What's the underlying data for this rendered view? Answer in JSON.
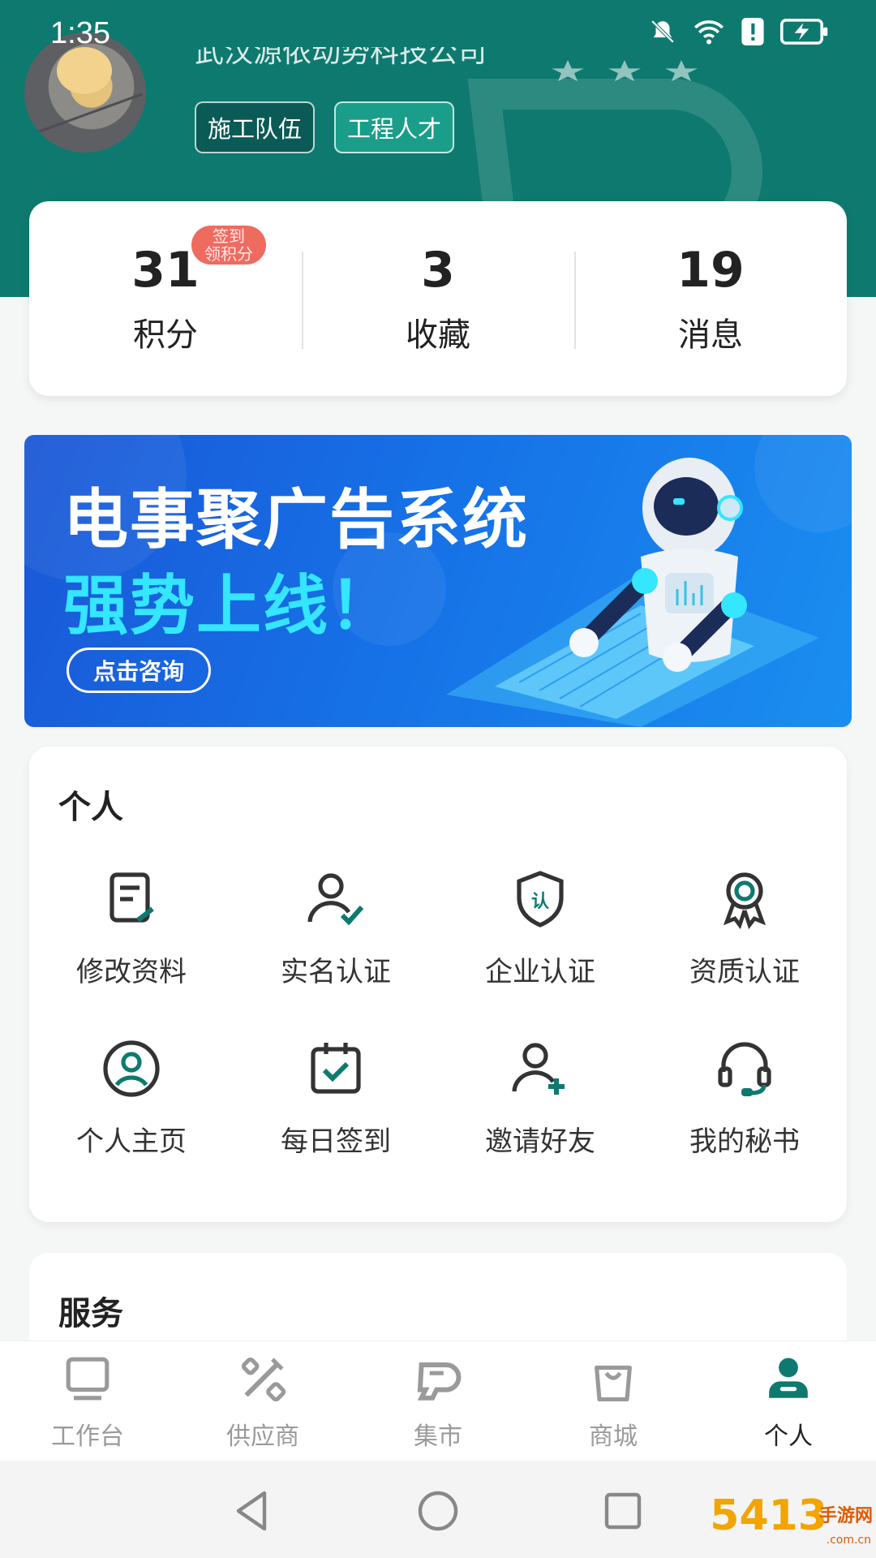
{
  "status_bar": {
    "time": "1:35"
  },
  "profile": {
    "name_partial": "武汉源侬动势科技公司",
    "tags": [
      "施工队伍",
      "工程人才"
    ]
  },
  "stats": [
    {
      "value": "31",
      "label": "积分"
    },
    {
      "value": "3",
      "label": "收藏"
    },
    {
      "value": "19",
      "label": "消息"
    }
  ],
  "sign_badge": "签到\n领积分",
  "banner": {
    "title_line1": "电事聚广告系统",
    "title_line2": "强势上线！",
    "button": "点击咨询"
  },
  "personal": {
    "title": "个人",
    "items": [
      {
        "label": "修改资料",
        "icon": "edit-document-icon"
      },
      {
        "label": "实名认证",
        "icon": "user-check-icon"
      },
      {
        "label": "企业认证",
        "icon": "shield-certify-icon"
      },
      {
        "label": "资质认证",
        "icon": "award-ribbon-icon"
      },
      {
        "label": "个人主页",
        "icon": "user-circle-icon"
      },
      {
        "label": "每日签到",
        "icon": "calendar-check-icon"
      },
      {
        "label": "邀请好友",
        "icon": "user-add-icon"
      },
      {
        "label": "我的秘书",
        "icon": "headset-icon"
      }
    ]
  },
  "service": {
    "title": "服务"
  },
  "tabbar": [
    {
      "label": "工作台",
      "icon": "monitor-icon",
      "active": false
    },
    {
      "label": "供应商",
      "icon": "tools-icon",
      "active": false
    },
    {
      "label": "集市",
      "icon": "market-logo-icon",
      "active": false
    },
    {
      "label": "商城",
      "icon": "shopping-bag-icon",
      "active": false
    },
    {
      "label": "个人",
      "icon": "person-icon",
      "active": true
    }
  ],
  "colors": {
    "brand": "#0e7a6f",
    "accent": "#1a9e8a",
    "badge": "#ef6b5f",
    "banner_blue": "#1670e6",
    "banner_cyan": "#34e6ff"
  }
}
